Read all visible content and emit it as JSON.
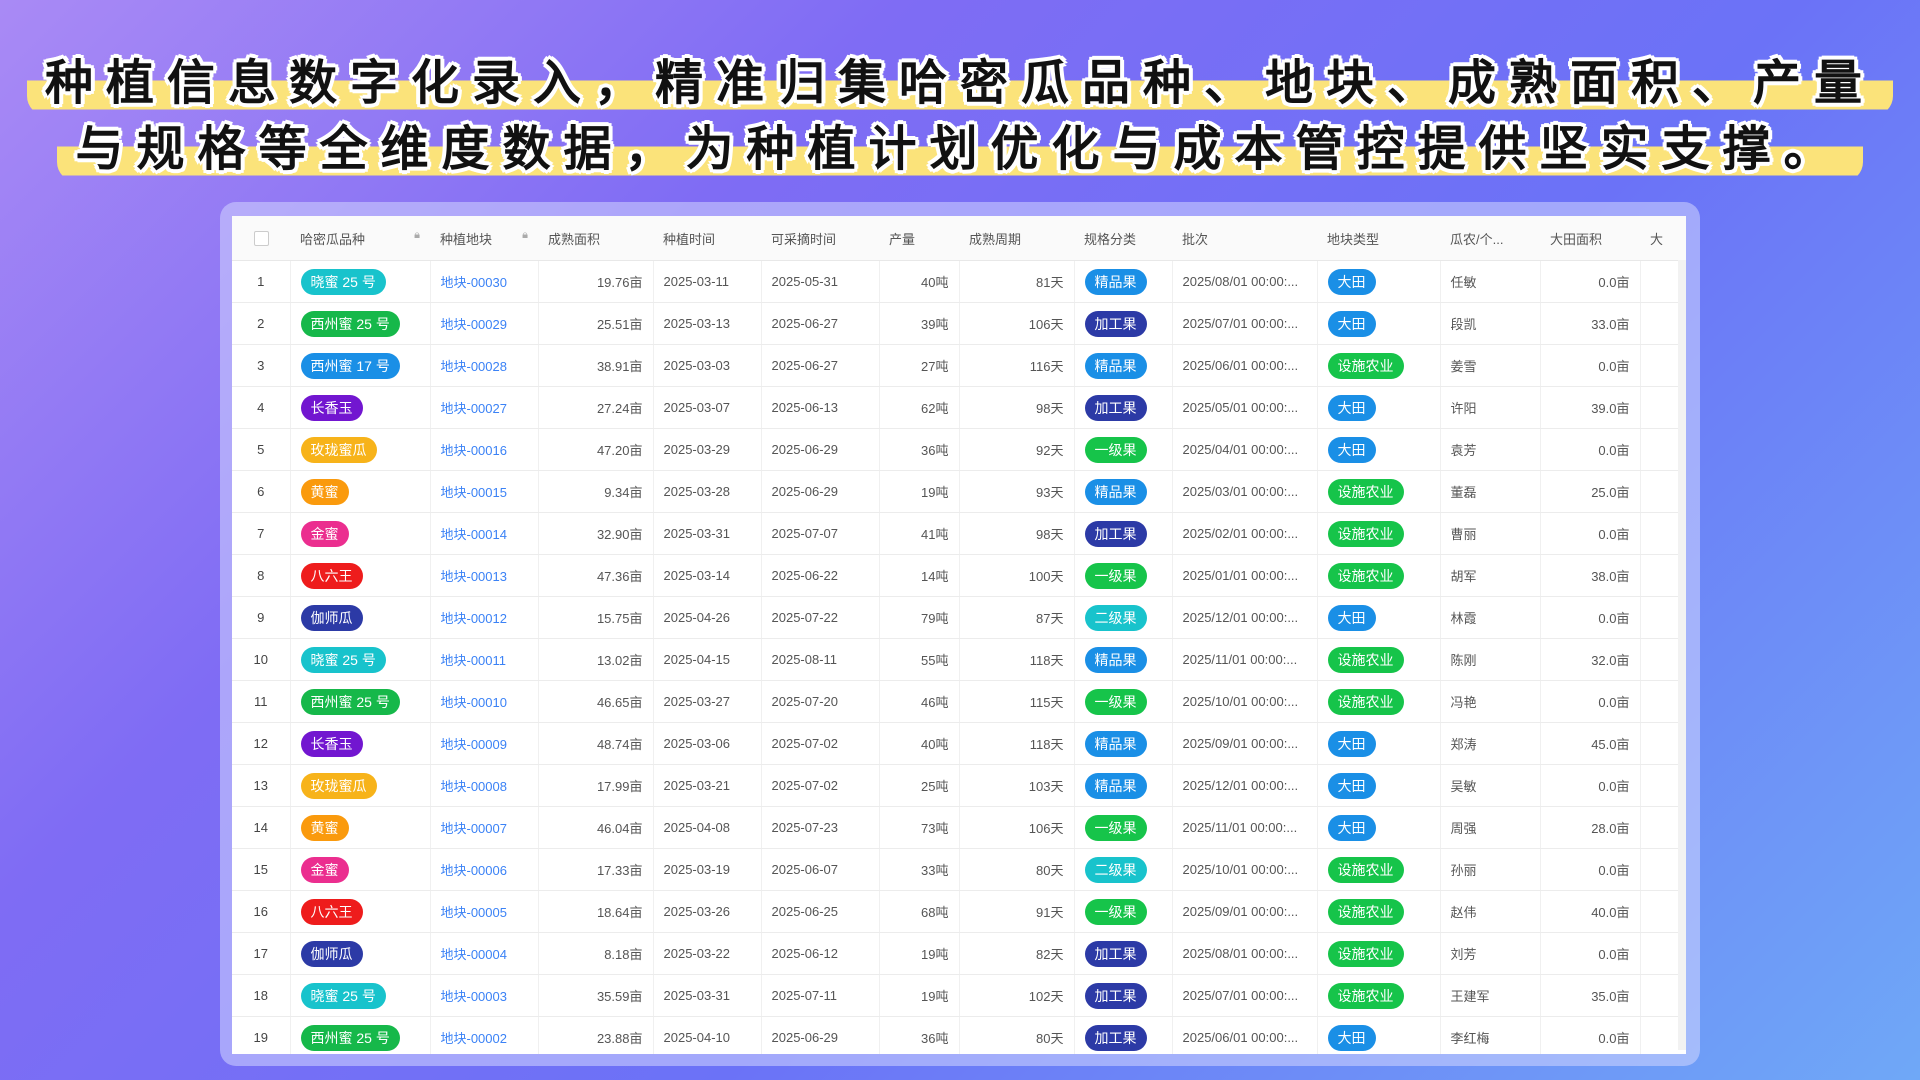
{
  "headline": {
    "line1": "种植信息数字化录入，精准归集哈密瓜品种、地块、成熟面积、产量",
    "line2": "与规格等全维度数据，为种植计划优化与成本管控提供坚实支撑。"
  },
  "colors": {
    "晓蜜 25 号": "#18c3cc",
    "西州蜜 25 号": "#16b84a",
    "西州蜜 17 号": "#1a8fe6",
    "长香玉": "#7216d0",
    "玫珑蜜瓜": "#f7b31a",
    "黄蜜": "#fa9a0d",
    "金蜜": "#eb2e8f",
    "八六王": "#ee1c1c",
    "伽师瓜": "#2c3aa6",
    "精品果": "#1a8fe6",
    "加工果": "#2c3aa6",
    "一级果": "#16c44a",
    "二级果": "#18c3cc",
    "大田": "#1a8fe6",
    "设施农业": "#16c44a"
  },
  "columns": [
    "",
    "哈密瓜品种",
    "种植地块",
    "成熟面积",
    "种植时间",
    "可采摘时间",
    "产量",
    "成熟周期",
    "规格分类",
    "批次",
    "地块类型",
    "瓜农/个...",
    "大田面积",
    "大"
  ],
  "rows": [
    {
      "no": "1",
      "variety": "晓蜜 25 号",
      "plot": "地块-00030",
      "area": "19.76亩",
      "plant": "2025-03-11",
      "harvest": "2025-05-31",
      "yield": "40吨",
      "cycle": "81天",
      "spec": "精品果",
      "batch": "2025/08/01 00:00:...",
      "type": "大田",
      "farmer": "任敏",
      "field": "0.0亩"
    },
    {
      "no": "2",
      "variety": "西州蜜 25 号",
      "plot": "地块-00029",
      "area": "25.51亩",
      "plant": "2025-03-13",
      "harvest": "2025-06-27",
      "yield": "39吨",
      "cycle": "106天",
      "spec": "加工果",
      "batch": "2025/07/01 00:00:...",
      "type": "大田",
      "farmer": "段凯",
      "field": "33.0亩"
    },
    {
      "no": "3",
      "variety": "西州蜜 17 号",
      "plot": "地块-00028",
      "area": "38.91亩",
      "plant": "2025-03-03",
      "harvest": "2025-06-27",
      "yield": "27吨",
      "cycle": "116天",
      "spec": "精品果",
      "batch": "2025/06/01 00:00:...",
      "type": "设施农业",
      "farmer": "姜雪",
      "field": "0.0亩"
    },
    {
      "no": "4",
      "variety": "长香玉",
      "plot": "地块-00027",
      "area": "27.24亩",
      "plant": "2025-03-07",
      "harvest": "2025-06-13",
      "yield": "62吨",
      "cycle": "98天",
      "spec": "加工果",
      "batch": "2025/05/01 00:00:...",
      "type": "大田",
      "farmer": "许阳",
      "field": "39.0亩"
    },
    {
      "no": "5",
      "variety": "玫珑蜜瓜",
      "plot": "地块-00016",
      "area": "47.20亩",
      "plant": "2025-03-29",
      "harvest": "2025-06-29",
      "yield": "36吨",
      "cycle": "92天",
      "spec": "一级果",
      "batch": "2025/04/01 00:00:...",
      "type": "大田",
      "farmer": "袁芳",
      "field": "0.0亩"
    },
    {
      "no": "6",
      "variety": "黄蜜",
      "plot": "地块-00015",
      "area": "9.34亩",
      "plant": "2025-03-28",
      "harvest": "2025-06-29",
      "yield": "19吨",
      "cycle": "93天",
      "spec": "精品果",
      "batch": "2025/03/01 00:00:...",
      "type": "设施农业",
      "farmer": "董磊",
      "field": "25.0亩"
    },
    {
      "no": "7",
      "variety": "金蜜",
      "plot": "地块-00014",
      "area": "32.90亩",
      "plant": "2025-03-31",
      "harvest": "2025-07-07",
      "yield": "41吨",
      "cycle": "98天",
      "spec": "加工果",
      "batch": "2025/02/01 00:00:...",
      "type": "设施农业",
      "farmer": "曹丽",
      "field": "0.0亩"
    },
    {
      "no": "8",
      "variety": "八六王",
      "plot": "地块-00013",
      "area": "47.36亩",
      "plant": "2025-03-14",
      "harvest": "2025-06-22",
      "yield": "14吨",
      "cycle": "100天",
      "spec": "一级果",
      "batch": "2025/01/01 00:00:...",
      "type": "设施农业",
      "farmer": "胡军",
      "field": "38.0亩"
    },
    {
      "no": "9",
      "variety": "伽师瓜",
      "plot": "地块-00012",
      "area": "15.75亩",
      "plant": "2025-04-26",
      "harvest": "2025-07-22",
      "yield": "79吨",
      "cycle": "87天",
      "spec": "二级果",
      "batch": "2025/12/01 00:00:...",
      "type": "大田",
      "farmer": "林霞",
      "field": "0.0亩"
    },
    {
      "no": "10",
      "variety": "晓蜜 25 号",
      "plot": "地块-00011",
      "area": "13.02亩",
      "plant": "2025-04-15",
      "harvest": "2025-08-11",
      "yield": "55吨",
      "cycle": "118天",
      "spec": "精品果",
      "batch": "2025/11/01 00:00:...",
      "type": "设施农业",
      "farmer": "陈刚",
      "field": "32.0亩"
    },
    {
      "no": "11",
      "variety": "西州蜜 25 号",
      "plot": "地块-00010",
      "area": "46.65亩",
      "plant": "2025-03-27",
      "harvest": "2025-07-20",
      "yield": "46吨",
      "cycle": "115天",
      "spec": "一级果",
      "batch": "2025/10/01 00:00:...",
      "type": "设施农业",
      "farmer": "冯艳",
      "field": "0.0亩"
    },
    {
      "no": "12",
      "variety": "长香玉",
      "plot": "地块-00009",
      "area": "48.74亩",
      "plant": "2025-03-06",
      "harvest": "2025-07-02",
      "yield": "40吨",
      "cycle": "118天",
      "spec": "精品果",
      "batch": "2025/09/01 00:00:...",
      "type": "大田",
      "farmer": "郑涛",
      "field": "45.0亩"
    },
    {
      "no": "13",
      "variety": "玫珑蜜瓜",
      "plot": "地块-00008",
      "area": "17.99亩",
      "plant": "2025-03-21",
      "harvest": "2025-07-02",
      "yield": "25吨",
      "cycle": "103天",
      "spec": "精品果",
      "batch": "2025/12/01 00:00:...",
      "type": "大田",
      "farmer": "吴敏",
      "field": "0.0亩"
    },
    {
      "no": "14",
      "variety": "黄蜜",
      "plot": "地块-00007",
      "area": "46.04亩",
      "plant": "2025-04-08",
      "harvest": "2025-07-23",
      "yield": "73吨",
      "cycle": "106天",
      "spec": "一级果",
      "batch": "2025/11/01 00:00:...",
      "type": "大田",
      "farmer": "周强",
      "field": "28.0亩"
    },
    {
      "no": "15",
      "variety": "金蜜",
      "plot": "地块-00006",
      "area": "17.33亩",
      "plant": "2025-03-19",
      "harvest": "2025-06-07",
      "yield": "33吨",
      "cycle": "80天",
      "spec": "二级果",
      "batch": "2025/10/01 00:00:...",
      "type": "设施农业",
      "farmer": "孙丽",
      "field": "0.0亩"
    },
    {
      "no": "16",
      "variety": "八六王",
      "plot": "地块-00005",
      "area": "18.64亩",
      "plant": "2025-03-26",
      "harvest": "2025-06-25",
      "yield": "68吨",
      "cycle": "91天",
      "spec": "一级果",
      "batch": "2025/09/01 00:00:...",
      "type": "设施农业",
      "farmer": "赵伟",
      "field": "40.0亩"
    },
    {
      "no": "17",
      "variety": "伽师瓜",
      "plot": "地块-00004",
      "area": "8.18亩",
      "plant": "2025-03-22",
      "harvest": "2025-06-12",
      "yield": "19吨",
      "cycle": "82天",
      "spec": "加工果",
      "batch": "2025/08/01 00:00:...",
      "type": "设施农业",
      "farmer": "刘芳",
      "field": "0.0亩"
    },
    {
      "no": "18",
      "variety": "晓蜜 25 号",
      "plot": "地块-00003",
      "area": "35.59亩",
      "plant": "2025-03-31",
      "harvest": "2025-07-11",
      "yield": "19吨",
      "cycle": "102天",
      "spec": "加工果",
      "batch": "2025/07/01 00:00:...",
      "type": "设施农业",
      "farmer": "王建军",
      "field": "35.0亩"
    },
    {
      "no": "19",
      "variety": "西州蜜 25 号",
      "plot": "地块-00002",
      "area": "23.88亩",
      "plant": "2025-04-10",
      "harvest": "2025-06-29",
      "yield": "36吨",
      "cycle": "80天",
      "spec": "加工果",
      "batch": "2025/06/01 00:00:...",
      "type": "大田",
      "farmer": "李红梅",
      "field": "0.0亩"
    }
  ]
}
